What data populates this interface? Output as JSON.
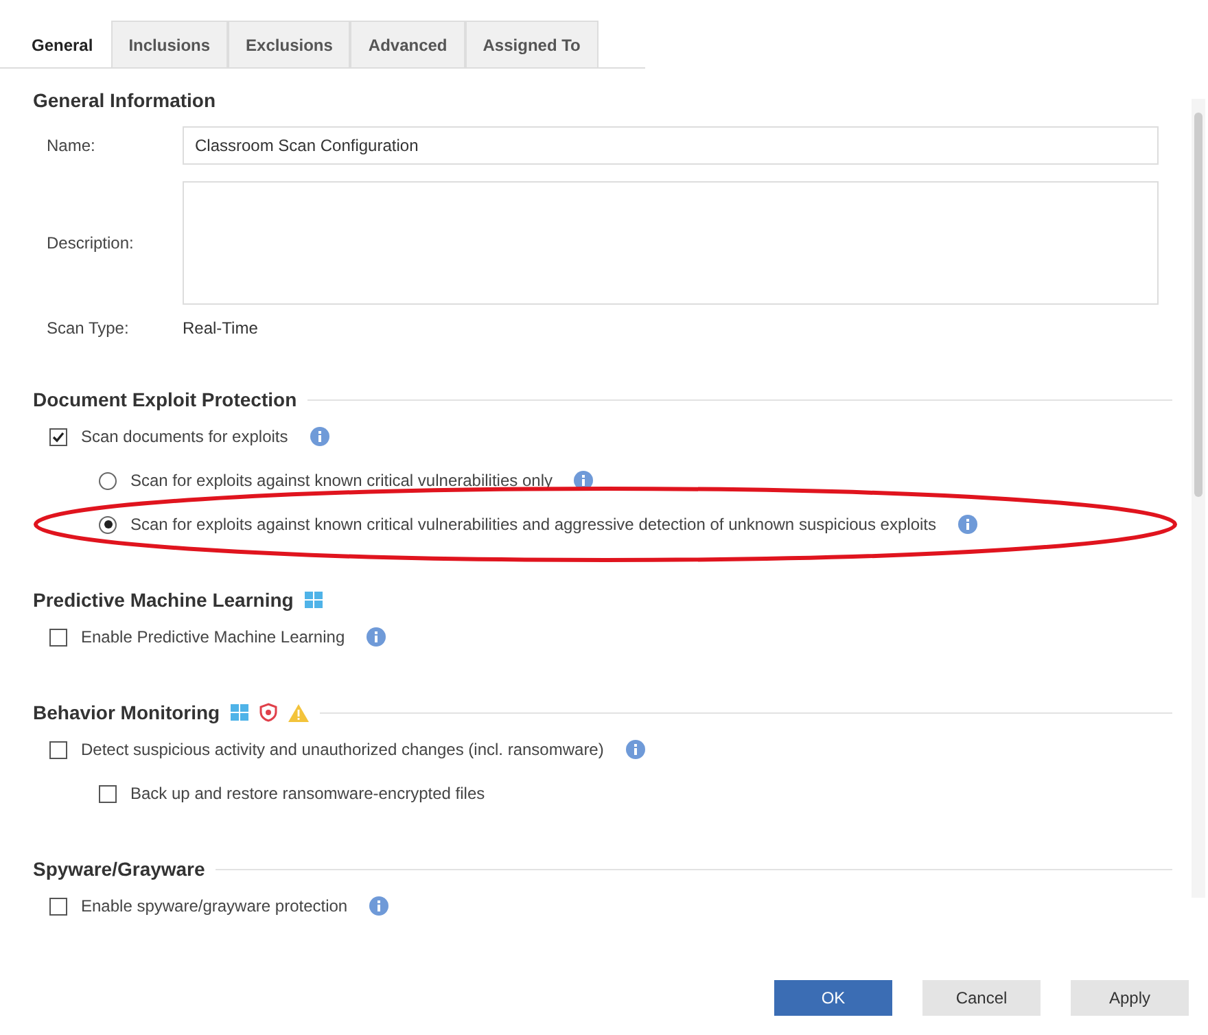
{
  "tabs": [
    {
      "label": "General",
      "selected": true
    },
    {
      "label": "Inclusions",
      "selected": false
    },
    {
      "label": "Exclusions",
      "selected": false
    },
    {
      "label": "Advanced",
      "selected": false
    },
    {
      "label": "Assigned To",
      "selected": false
    }
  ],
  "general_information": {
    "title": "General Information",
    "name_label": "Name:",
    "name_value": "Classroom Scan Configuration",
    "description_label": "Description:",
    "scan_type_label": "Scan Type:",
    "scan_type_value": "Real-Time"
  },
  "sections": [
    {
      "title": "Document Exploit Protection",
      "items": [
        {
          "kind": "checkbox",
          "label": "Scan documents for exploits",
          "checked": true,
          "info": true,
          "children": [
            {
              "kind": "radio",
              "label": "Scan for exploits against known critical vulnerabilities only",
              "selected": false,
              "info": true
            },
            {
              "kind": "radio",
              "label": "Scan for exploits against known critical vulnerabilities and aggressive detection of unknown suspicious exploits",
              "selected": true,
              "info": true,
              "highlighted": true
            }
          ]
        }
      ]
    },
    {
      "title": "Predictive Machine Learning",
      "items": [
        {
          "kind": "checkbox",
          "label": "Enable Predictive Machine Learning",
          "checked": false,
          "info": true
        }
      ]
    },
    {
      "title": "Behavior Monitoring",
      "items": [
        {
          "kind": "checkbox",
          "label": "Detect suspicious activity and unauthorized changes (incl. ransomware)",
          "checked": false,
          "info": true,
          "children": [
            {
              "kind": "checkbox",
              "label": "Back up and restore ransomware-encrypted files",
              "checked": false
            }
          ]
        }
      ]
    },
    {
      "title": "Spyware/Grayware",
      "items": [
        {
          "kind": "checkbox",
          "label": "Enable spyware/grayware protection",
          "checked": false,
          "info": true
        }
      ]
    }
  ],
  "buttons": [
    {
      "label": "OK",
      "primary": true
    },
    {
      "label": "Cancel",
      "primary": false
    },
    {
      "label": "Apply",
      "primary": false
    }
  ]
}
